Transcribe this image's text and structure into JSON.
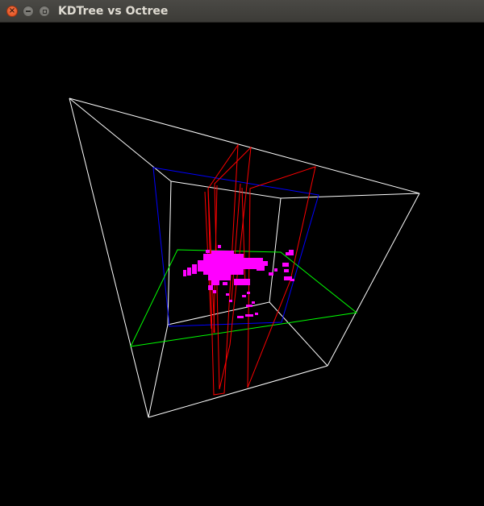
{
  "window": {
    "title": "KDTree vs Octree",
    "controls": {
      "close_icon": "close-icon",
      "minimize_icon": "minimize-icon",
      "maximize_icon": "maximize-icon"
    }
  },
  "scene": {
    "background_color": "#000000",
    "colors": {
      "bounding_box": "#ffffff",
      "kdtree_split_x": "#ff0000",
      "kdtree_split_z": "#0000ff",
      "kdtree_split_y": "#00ff00",
      "points": "#ff00ff"
    }
  }
}
